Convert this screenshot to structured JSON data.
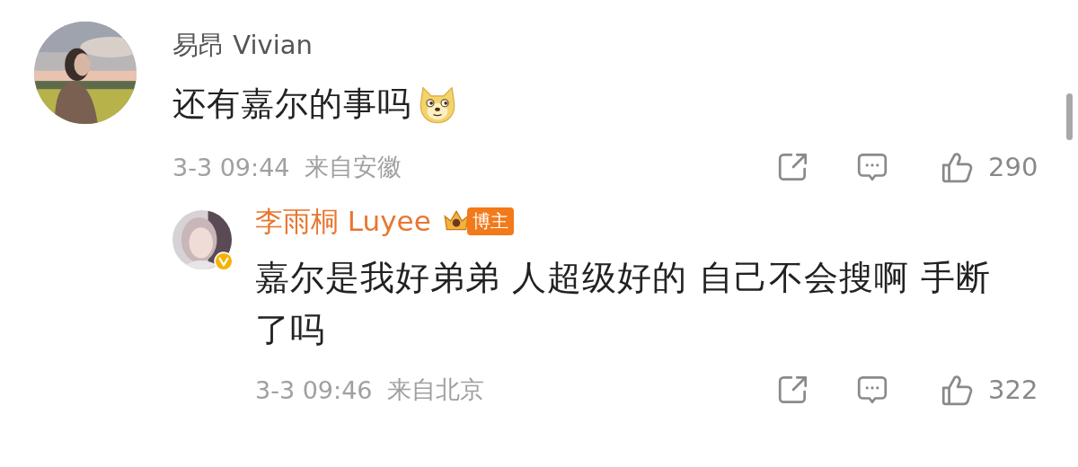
{
  "comments": [
    {
      "author": "易昂 Vivian",
      "is_author": false,
      "content": [
        {
          "kind": "text",
          "text": "还有嘉尔的事吗"
        },
        {
          "kind": "emoji"
        }
      ],
      "time": "3-3 09:44",
      "location": "来自安徽",
      "likes": "290",
      "replies": [
        {
          "author": "李雨桐 Luyee",
          "is_author": true,
          "verified": true,
          "badge": "博主",
          "content": [
            {
              "kind": "text",
              "text": "嘉尔是我好弟弟 人超级好的 自己不会搜啊 手断了吗"
            }
          ],
          "time": "3-3 09:46",
          "location": "来自北京",
          "likes": "322"
        }
      ]
    }
  ]
}
